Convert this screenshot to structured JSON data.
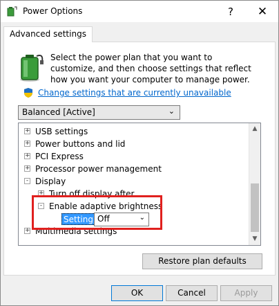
{
  "window": {
    "title": "Power Options"
  },
  "titlebar": {
    "help_glyph": "?",
    "close_glyph": "✕"
  },
  "tab": {
    "label": "Advanced settings"
  },
  "description": "Select the power plan that you want to customize, and then choose settings that reflect how you want your computer to manage power.",
  "change_link": "Change settings that are currently unavailable",
  "plan_select": {
    "value": "Balanced [Active]"
  },
  "tree": {
    "items": [
      {
        "label": "USB settings",
        "expander": "+"
      },
      {
        "label": "Power buttons and lid",
        "expander": "+"
      },
      {
        "label": "PCI Express",
        "expander": "+"
      },
      {
        "label": "Processor power management",
        "expander": "+"
      },
      {
        "label": "Display",
        "expander": "-"
      },
      {
        "label": "Turn off display after",
        "expander": "+"
      },
      {
        "label": "Enable adaptive brightness",
        "expander": "-"
      },
      {
        "label": "Multimedia settings",
        "expander": "+"
      }
    ],
    "setting_label": "Setting:",
    "setting_value": "Off"
  },
  "buttons": {
    "restore": "Restore plan defaults",
    "ok": "OK",
    "cancel": "Cancel",
    "apply": "Apply"
  },
  "colors": {
    "highlight": "#e0201e",
    "link": "#0066cc",
    "selection": "#3399ff"
  }
}
